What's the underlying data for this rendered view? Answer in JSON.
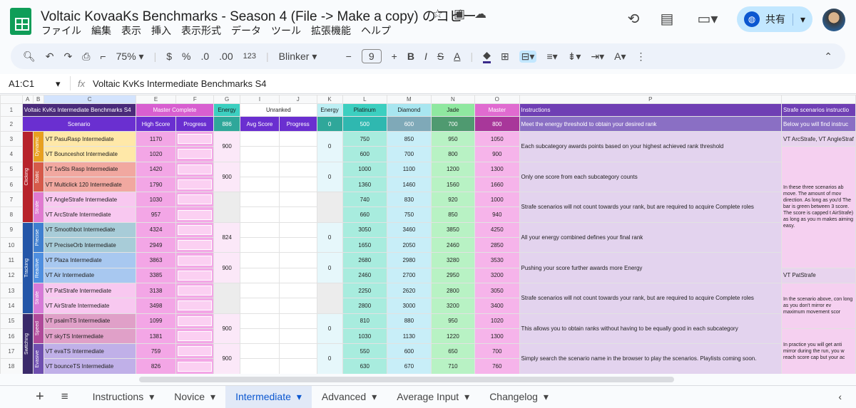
{
  "app": {
    "title": "Voltaic KovaaKs Benchmarks - Season 4 (File -> Make a copy) のコピー",
    "share_label": "共有"
  },
  "menu": [
    "ファイル",
    "編集",
    "表示",
    "挿入",
    "表示形式",
    "データ",
    "ツール",
    "拡張機能",
    "ヘルプ"
  ],
  "toolbar": {
    "zoom": "75%",
    "currency": "$",
    "percent": "%",
    "dec_down": ".0",
    "dec_up": ".00",
    "format123": "123",
    "font": "Blinker",
    "font_size": "9",
    "minus": "−",
    "plus": "+",
    "bold": "B"
  },
  "formula": {
    "cell_ref": "A1:C1",
    "fx": "fx",
    "content": "Voltaic KvKs Intermediate Benchmarks S4"
  },
  "columns": [
    "A",
    "B",
    "C",
    "E",
    "F",
    "G",
    "I",
    "J",
    "K",
    "L",
    "M",
    "N",
    "O",
    "P"
  ],
  "row1": {
    "title": "Voltaic KvKs Intermediate Benchmarks S4",
    "master_complete": "Master Complete",
    "energy": "Energy",
    "unranked": "Unranked",
    "energy2": "Energy",
    "platinum": "Platinum",
    "diamond": "Diamond",
    "jade": "Jade",
    "master": "Master",
    "instructions": "Instructions",
    "strafe_hdr": "Strafe scenarios instructio"
  },
  "row2": {
    "scenario": "Scenario",
    "high_score": "High Score",
    "progress": "Progress",
    "energy": "886",
    "avg_score": "Avg Score",
    "progress2": "Progress",
    "unranked_energy": "0",
    "platinum": "500",
    "diamond": "600",
    "jade": "700",
    "master": "800",
    "instructions": "Meet the energy threshold to obtain your desired rank",
    "strafe": "Below you will find instruc"
  },
  "categories": [
    "Clicking",
    "Tracking",
    "Switching"
  ],
  "subcategories": [
    "Dynamic",
    "Static",
    "Strafe",
    "Precise",
    "Reactive",
    "Strafe",
    "Speed",
    "Evasive"
  ],
  "rows": [
    {
      "n": "3",
      "name": "VT PasuRasp Intermediate",
      "hs": "1170",
      "p": "750",
      "d": "850",
      "j": "950",
      "m": "1050"
    },
    {
      "n": "4",
      "name": "VT Bounceshot Intermediate",
      "hs": "1020",
      "p": "600",
      "d": "700",
      "j": "800",
      "m": "900"
    },
    {
      "n": "5",
      "name": "VT 1wSts Rasp Intermediate",
      "hs": "1420",
      "p": "1000",
      "d": "1100",
      "j": "1200",
      "m": "1300"
    },
    {
      "n": "6",
      "name": "VT Multiclick 120 Intermediate",
      "hs": "1790",
      "p": "1360",
      "d": "1460",
      "j": "1560",
      "m": "1660"
    },
    {
      "n": "7",
      "name": "VT AngleStrafe Intermediate",
      "hs": "1030",
      "p": "740",
      "d": "830",
      "j": "920",
      "m": "1000"
    },
    {
      "n": "8",
      "name": "VT ArcStrafe Intermediate",
      "hs": "957",
      "p": "660",
      "d": "750",
      "j": "850",
      "m": "940"
    },
    {
      "n": "9",
      "name": "VT Smoothbot Intermediate",
      "hs": "4324",
      "p": "3050",
      "d": "3460",
      "j": "3850",
      "m": "4250"
    },
    {
      "n": "10",
      "name": "VT PreciseOrb Intermediate",
      "hs": "2949",
      "p": "1650",
      "d": "2050",
      "j": "2460",
      "m": "2850"
    },
    {
      "n": "11",
      "name": "VT Plaza Intermediate",
      "hs": "3863",
      "p": "2680",
      "d": "2980",
      "j": "3280",
      "m": "3530"
    },
    {
      "n": "12",
      "name": "VT Air Intermediate",
      "hs": "3385",
      "p": "2460",
      "d": "2700",
      "j": "2950",
      "m": "3200"
    },
    {
      "n": "13",
      "name": "VT PatStrafe Intermediate",
      "hs": "3138",
      "p": "2250",
      "d": "2620",
      "j": "2800",
      "m": "3050"
    },
    {
      "n": "14",
      "name": "VT AirStrafe Intermediate",
      "hs": "3498",
      "p": "2800",
      "d": "3000",
      "j": "3200",
      "m": "3400"
    },
    {
      "n": "15",
      "name": "VT psalmTS Intermediate",
      "hs": "1099",
      "p": "810",
      "d": "880",
      "j": "950",
      "m": "1020"
    },
    {
      "n": "16",
      "name": "VT skyTS Intermediate",
      "hs": "1381",
      "p": "1030",
      "d": "1130",
      "j": "1220",
      "m": "1300"
    },
    {
      "n": "17",
      "name": "VT evaTS Intermediate",
      "hs": "759",
      "p": "550",
      "d": "600",
      "j": "650",
      "m": "700"
    },
    {
      "n": "18",
      "name": "VT bounceTS Intermediate",
      "hs": "826",
      "p": "630",
      "d": "670",
      "j": "710",
      "m": "760"
    }
  ],
  "energy_groups": [
    "900",
    "900",
    "",
    "824",
    "900",
    "",
    "900",
    "900"
  ],
  "unranked_groups": [
    "0",
    "0",
    "",
    "0",
    "0",
    "",
    "0",
    "0"
  ],
  "instructions": [
    "Each subcategory awards points based on your highest achieved rank threshold",
    "Only one score from each subcategory counts",
    "Strafe scenarios will not count towards your rank, but are required to acquire Complete roles",
    "All your energy combined defines your final rank",
    "Pushing your score further awards more Energy",
    "Strafe scenarios will not count towards your rank, but are required to acquire Complete roles",
    "This allows you to obtain ranks without having to be equally good in each subcategory",
    "Simply search the scenario name in the browser to play the scenarios. Playlists coming soon."
  ],
  "strafe_text": {
    "r3": "VT ArcStrafe, VT AngleStraf",
    "block1": "In these three scenarios ab move. The amount of mov direction. As long as you'd The bar is green between 3 score. The score is capped t AirStrafe) as long as you m makes aiming easy.",
    "r12": "VT PatStrafe",
    "block2": "In the scenario above, con long as you don't mirror ev maximum movement scor",
    "block3": "In practice you will get anti mirror during the run, you w reach score cap but your ac"
  },
  "tabs": [
    {
      "label": "Instructions"
    },
    {
      "label": "Novice"
    },
    {
      "label": "Intermediate",
      "active": true
    },
    {
      "label": "Advanced"
    },
    {
      "label": "Average Input"
    },
    {
      "label": "Changelog"
    }
  ],
  "colors": {
    "purple_hdr": "#6f3fb4",
    "dark_purple": "#4a2a7a",
    "pink": "#f3a6e6",
    "platinum": "#3ccfc0",
    "diamond": "#9fd8e8",
    "jade": "#8fe8a0",
    "master": "#e06bd0",
    "instr_bg": "#e3d3ee"
  }
}
